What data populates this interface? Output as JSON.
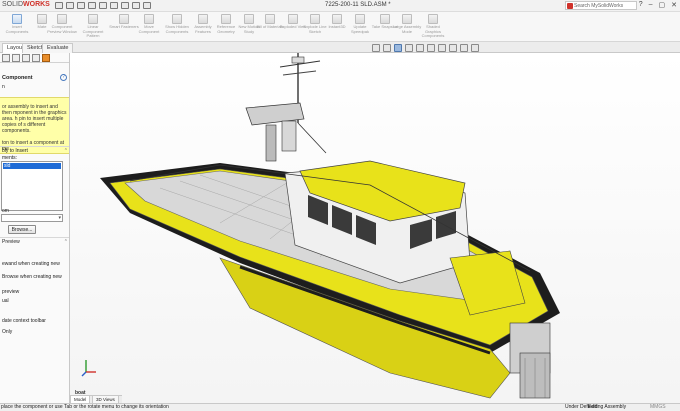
{
  "app": {
    "brand_a": "SOLID",
    "brand_b": "WORKS",
    "document_title": "7225-200-11 SLD.ASM *"
  },
  "search": {
    "placeholder": "Search MySolidWorks"
  },
  "window_buttons": [
    "?",
    "–",
    "▢",
    "✕"
  ],
  "command_manager": {
    "items": [
      "Insert Components",
      "Mate",
      "Component Preview Window",
      "Linear Component Pattern",
      "Smart Fasteners",
      "Move Component",
      "Show Hidden Components",
      "Assembly Features",
      "Reference Geometry",
      "New Motion Study",
      "Bill of Materials",
      "Exploded View",
      "Explode Line Sketch",
      "Instant3D",
      "Update Speedpak",
      "Take Snapshot",
      "Large Assembly Mode",
      "Shaded Graphics Components"
    ]
  },
  "tabs": [
    "Layout",
    "Sketch",
    "Evaluate"
  ],
  "panel": {
    "title": "Component",
    "message_header": "n",
    "message": "or assembly to insert and then mponent in the graphics area. h pin to insert multiple copies of s different components.\n\nton to insert a component at the",
    "sections": {
      "part_assembly": "bly to Insert",
      "open_documents": "ments:",
      "selected_doc": "sld",
      "from": "om",
      "browse": "Browse...",
      "preview": "Preview"
    },
    "options": [
      "ewand when creating new",
      "Browse when creating new",
      "preview",
      "ual",
      "",
      "date context toolbar",
      "Only"
    ]
  },
  "viewport": {
    "label": "boat"
  },
  "model_tabs": [
    "Model",
    "3D Views"
  ],
  "status_bar": {
    "message": "place the component or use Tab or the rotate menu to change its orientation",
    "state": "Under Defined",
    "mode": "Editing Assembly",
    "units": "MMGS"
  },
  "colors": {
    "hull_yellow": "#e8e21a",
    "hull_dark": "#1d1d1d",
    "accent_red": "#d0322b"
  }
}
